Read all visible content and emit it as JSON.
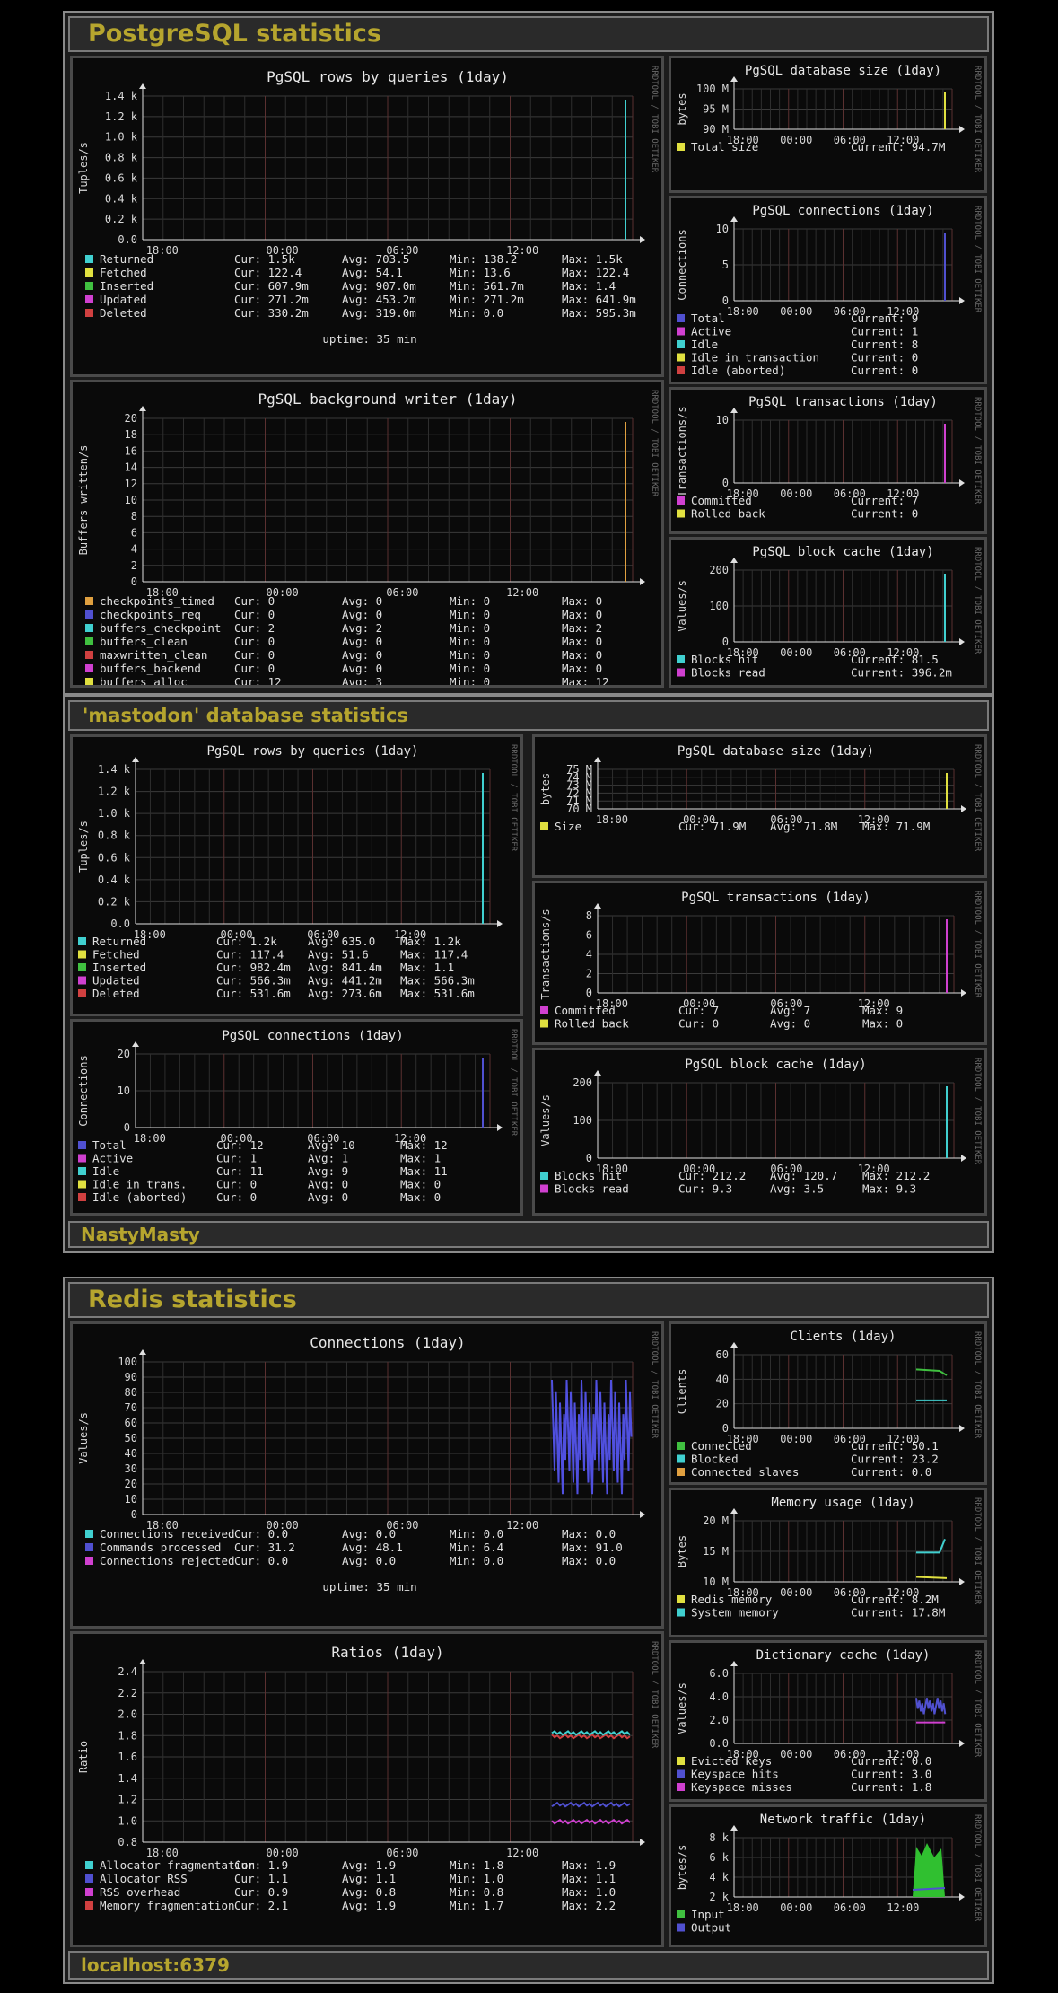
{
  "sections": [
    {
      "title": "PostgreSQL statistics",
      "footer": ""
    },
    {
      "title": "'mastodon' database statistics",
      "footer": "NastyMasty"
    },
    {
      "title": "Redis statistics",
      "footer": "localhost:6379"
    }
  ],
  "watermark": "RRDTOOL / TOBI OETIKER",
  "panels": {
    "pg_rows": {
      "title": "PgSQL rows by queries  (1day)",
      "ylabel": "Tuples/s",
      "yticks": [
        "1.4 k",
        "1.2 k",
        "1.0 k",
        "0.8 k",
        "0.6 k",
        "0.4 k",
        "0.2 k",
        "0.0"
      ],
      "xticks": [
        "18:00",
        "00:00",
        "06:00",
        "12:00"
      ],
      "legend": [
        {
          "color": "#40d0d0",
          "label": "Returned",
          "cur": "Cur:   1.5k",
          "avg": "Avg: 703.5",
          "min": "Min: 138.2",
          "max": "Max:   1.5k"
        },
        {
          "color": "#e0e040",
          "label": "Fetched",
          "cur": "Cur: 122.4",
          "avg": "Avg:  54.1",
          "min": "Min:  13.6",
          "max": "Max: 122.4"
        },
        {
          "color": "#40c040",
          "label": "Inserted",
          "cur": "Cur: 607.9m",
          "avg": "Avg: 907.0m",
          "min": "Min: 561.7m",
          "max": "Max:   1.4"
        },
        {
          "color": "#d040d0",
          "label": "Updated",
          "cur": "Cur: 271.2m",
          "avg": "Avg: 453.2m",
          "min": "Min: 271.2m",
          "max": "Max: 641.9m"
        },
        {
          "color": "#d04040",
          "label": "Deleted",
          "cur": "Cur: 330.2m",
          "avg": "Avg: 319.0m",
          "min": "Min:   0.0",
          "max": "Max: 595.3m"
        }
      ],
      "extra": "uptime:  35 min"
    },
    "pg_bgwriter": {
      "title": "PgSQL background writer  (1day)",
      "ylabel": "Buffers written/s",
      "yticks": [
        "20",
        "18",
        "16",
        "14",
        "12",
        "10",
        "8",
        "6",
        "4",
        "2",
        "0"
      ],
      "xticks": [
        "18:00",
        "00:00",
        "06:00",
        "12:00"
      ],
      "legend": [
        {
          "color": "#e0a040",
          "label": "checkpoints_timed",
          "cur": "Cur:   0",
          "avg": "Avg:   0",
          "min": "Min:   0",
          "max": "Max:   0"
        },
        {
          "color": "#5050d0",
          "label": "checkpoints_req",
          "cur": "Cur:   0",
          "avg": "Avg:   0",
          "min": "Min:   0",
          "max": "Max:   0"
        },
        {
          "color": "#40d0d0",
          "label": "buffers_checkpoint",
          "cur": "Cur:   2",
          "avg": "Avg:   2",
          "min": "Min:   0",
          "max": "Max:   2"
        },
        {
          "color": "#40c040",
          "label": "buffers_clean",
          "cur": "Cur:   0",
          "avg": "Avg:   0",
          "min": "Min:   0",
          "max": "Max:   0"
        },
        {
          "color": "#d04040",
          "label": "maxwritten_clean",
          "cur": "Cur:   0",
          "avg": "Avg:   0",
          "min": "Min:   0",
          "max": "Max:   0"
        },
        {
          "color": "#d040d0",
          "label": "buffers_backend",
          "cur": "Cur:   0",
          "avg": "Avg:   0",
          "min": "Min:   0",
          "max": "Max:   0"
        },
        {
          "color": "#e0e040",
          "label": "buffers_alloc",
          "cur": "Cur:  12",
          "avg": "Avg:   3",
          "min": "Min:   0",
          "max": "Max:  12"
        }
      ]
    },
    "pg_dbsize": {
      "title": "PgSQL database size  (1day)",
      "ylabel": "bytes",
      "yticks": [
        "100 M",
        "95 M",
        "90 M"
      ],
      "xticks": [
        "18:00",
        "00:00",
        "06:00",
        "12:00"
      ],
      "legend": [
        {
          "color": "#e0e040",
          "label": "Total size",
          "cur": "Current:  94.7M"
        }
      ]
    },
    "pg_conn": {
      "title": "PgSQL connections  (1day)",
      "ylabel": "Connections",
      "yticks": [
        "10",
        "5",
        "0"
      ],
      "xticks": [
        "18:00",
        "00:00",
        "06:00",
        "12:00"
      ],
      "legend": [
        {
          "color": "#5050d0",
          "label": "Total",
          "cur": "Current:    9"
        },
        {
          "color": "#d040d0",
          "label": "Active",
          "cur": "Current:    1"
        },
        {
          "color": "#40d0d0",
          "label": "Idle",
          "cur": "Current:    8"
        },
        {
          "color": "#e0e040",
          "label": "Idle in transaction",
          "cur": "Current:    0"
        },
        {
          "color": "#d04040",
          "label": "Idle (aborted)",
          "cur": "Current:    0"
        }
      ]
    },
    "pg_tx": {
      "title": "PgSQL transactions  (1day)",
      "ylabel": "Transactions/s",
      "yticks": [
        "10",
        "0"
      ],
      "xticks": [
        "18:00",
        "00:00",
        "06:00",
        "12:00"
      ],
      "legend": [
        {
          "color": "#d040d0",
          "label": "Committed",
          "cur": "Current:    7"
        },
        {
          "color": "#e0e040",
          "label": "Rolled back",
          "cur": "Current:    0"
        }
      ]
    },
    "pg_cache": {
      "title": "PgSQL block cache  (1day)",
      "ylabel": "Values/s",
      "yticks": [
        "200",
        "100",
        "0"
      ],
      "xticks": [
        "18:00",
        "00:00",
        "06:00",
        "12:00"
      ],
      "legend": [
        {
          "color": "#40d0d0",
          "label": "Blocks hit",
          "cur": "Current:  81.5"
        },
        {
          "color": "#d040d0",
          "label": "Blocks read",
          "cur": "Current: 396.2m"
        }
      ]
    },
    "m_rows": {
      "title": "PgSQL rows by queries  (1day)",
      "ylabel": "Tuples/s",
      "yticks": [
        "1.4 k",
        "1.2 k",
        "1.0 k",
        "0.8 k",
        "0.6 k",
        "0.4 k",
        "0.2 k",
        "0.0"
      ],
      "xticks": [
        "18:00",
        "00:00",
        "06:00",
        "12:00"
      ],
      "legend": [
        {
          "color": "#40d0d0",
          "label": "Returned",
          "cur": "Cur:   1.2k",
          "avg": "Avg: 635.0",
          "max": "Max:   1.2k"
        },
        {
          "color": "#e0e040",
          "label": "Fetched",
          "cur": "Cur: 117.4",
          "avg": "Avg:  51.6",
          "max": "Max: 117.4"
        },
        {
          "color": "#40c040",
          "label": "Inserted",
          "cur": "Cur: 982.4m",
          "avg": "Avg: 841.4m",
          "max": "Max:   1.1"
        },
        {
          "color": "#d040d0",
          "label": "Updated",
          "cur": "Cur: 566.3m",
          "avg": "Avg: 441.2m",
          "max": "Max: 566.3m"
        },
        {
          "color": "#d04040",
          "label": "Deleted",
          "cur": "Cur: 531.6m",
          "avg": "Avg: 273.6m",
          "max": "Max: 531.6m"
        }
      ]
    },
    "m_conn": {
      "title": "PgSQL connections  (1day)",
      "ylabel": "Connections",
      "yticks": [
        "20",
        "10",
        "0"
      ],
      "xticks": [
        "18:00",
        "00:00",
        "06:00",
        "12:00"
      ],
      "legend": [
        {
          "color": "#5050d0",
          "label": "Total",
          "cur": "Cur:   12",
          "avg": "Avg:   10",
          "max": "Max:   12"
        },
        {
          "color": "#d040d0",
          "label": "Active",
          "cur": "Cur:    1",
          "avg": "Avg:    1",
          "max": "Max:    1"
        },
        {
          "color": "#40d0d0",
          "label": "Idle",
          "cur": "Cur:   11",
          "avg": "Avg:    9",
          "max": "Max:   11"
        },
        {
          "color": "#e0e040",
          "label": "Idle in trans.",
          "cur": "Cur:    0",
          "avg": "Avg:    0",
          "max": "Max:    0"
        },
        {
          "color": "#d04040",
          "label": "Idle (aborted)",
          "cur": "Cur:    0",
          "avg": "Avg:    0",
          "max": "Max:    0"
        }
      ]
    },
    "m_dbsize": {
      "title": "PgSQL database size  (1day)",
      "ylabel": "bytes",
      "yticks": [
        "75 M",
        "74 M",
        "73 M",
        "72 M",
        "71 M",
        "70 M"
      ],
      "xticks": [
        "18:00",
        "00:00",
        "06:00",
        "12:00"
      ],
      "legend": [
        {
          "color": "#e0e040",
          "label": "Size",
          "cur": "Cur:  71.9M",
          "avg": "Avg:  71.8M",
          "max": "Max:  71.9M"
        }
      ]
    },
    "m_tx": {
      "title": "PgSQL transactions  (1day)",
      "ylabel": "Transactions/s",
      "yticks": [
        "8",
        "6",
        "4",
        "2",
        "0"
      ],
      "xticks": [
        "18:00",
        "00:00",
        "06:00",
        "12:00"
      ],
      "legend": [
        {
          "color": "#d040d0",
          "label": "Committed",
          "cur": "Cur:    7",
          "avg": "Avg:    7",
          "max": "Max:    9"
        },
        {
          "color": "#e0e040",
          "label": "Rolled back",
          "cur": "Cur:    0",
          "avg": "Avg:    0",
          "max": "Max:    0"
        }
      ]
    },
    "m_cache": {
      "title": "PgSQL block cache  (1day)",
      "ylabel": "Values/s",
      "yticks": [
        "200",
        "100",
        "0"
      ],
      "xticks": [
        "18:00",
        "00:00",
        "06:00",
        "12:00"
      ],
      "legend": [
        {
          "color": "#40d0d0",
          "label": "Blocks hit",
          "cur": "Cur: 212.2",
          "avg": "Avg: 120.7",
          "max": "Max: 212.2"
        },
        {
          "color": "#d040d0",
          "label": "Blocks read",
          "cur": "Cur:   9.3",
          "avg": "Avg:   3.5",
          "max": "Max:   9.3"
        }
      ]
    },
    "r_conn": {
      "title": "Connections  (1day)",
      "ylabel": "Values/s",
      "yticks": [
        "100",
        "90",
        "80",
        "70",
        "60",
        "50",
        "40",
        "30",
        "20",
        "10",
        "0"
      ],
      "xticks": [
        "18:00",
        "00:00",
        "06:00",
        "12:00"
      ],
      "legend": [
        {
          "color": "#40d0d0",
          "label": "Connections received",
          "cur": "Cur:  0.0",
          "avg": "Avg:  0.0",
          "min": "Min:  0.0",
          "max": "Max:  0.0"
        },
        {
          "color": "#5050d0",
          "label": "Commands processed",
          "cur": "Cur: 31.2",
          "avg": "Avg: 48.1",
          "min": "Min:  6.4",
          "max": "Max: 91.0"
        },
        {
          "color": "#d040d0",
          "label": "Connections rejected",
          "cur": "Cur:  0.0",
          "avg": "Avg:  0.0",
          "min": "Min:  0.0",
          "max": "Max:  0.0"
        }
      ],
      "extra": "uptime:  35 min"
    },
    "r_ratios": {
      "title": "Ratios  (1day)",
      "ylabel": "Ratio",
      "yticks": [
        "2.4",
        "2.2",
        "2.0",
        "1.8",
        "1.6",
        "1.4",
        "1.2",
        "1.0",
        "0.8"
      ],
      "xticks": [
        "18:00",
        "00:00",
        "06:00",
        "12:00"
      ],
      "legend": [
        {
          "color": "#40d0d0",
          "label": "Allocator fragmentation",
          "cur": "Cur:  1.9",
          "avg": "Avg:  1.9",
          "min": "Min:  1.8",
          "max": "Max:  1.9"
        },
        {
          "color": "#5050d0",
          "label": "Allocator RSS",
          "cur": "Cur:  1.1",
          "avg": "Avg:  1.1",
          "min": "Min:  1.0",
          "max": "Max:  1.1"
        },
        {
          "color": "#d040d0",
          "label": "RSS overhead",
          "cur": "Cur:  0.9",
          "avg": "Avg:  0.8",
          "min": "Min:  0.8",
          "max": "Max:  1.0"
        },
        {
          "color": "#d04040",
          "label": "Memory fragmentation",
          "cur": "Cur:  2.1",
          "avg": "Avg:  1.9",
          "min": "Min:  1.7",
          "max": "Max:  2.2"
        }
      ]
    },
    "r_clients": {
      "title": "Clients  (1day)",
      "ylabel": "Clients",
      "yticks": [
        "60",
        "40",
        "20",
        "0"
      ],
      "xticks": [
        "18:00",
        "00:00",
        "06:00",
        "12:00"
      ],
      "legend": [
        {
          "color": "#40c040",
          "label": "Connected",
          "cur": "Current: 50.1"
        },
        {
          "color": "#40d0d0",
          "label": "Blocked",
          "cur": "Current: 23.2"
        },
        {
          "color": "#e0a040",
          "label": "Connected slaves",
          "cur": "Current:  0.0"
        }
      ]
    },
    "r_mem": {
      "title": "Memory usage  (1day)",
      "ylabel": "Bytes",
      "yticks": [
        "20 M",
        "15 M",
        "10 M"
      ],
      "xticks": [
        "18:00",
        "00:00",
        "06:00",
        "12:00"
      ],
      "legend": [
        {
          "color": "#e0e040",
          "label": "Redis memory",
          "cur": "Current:  8.2M"
        },
        {
          "color": "#40d0d0",
          "label": "System memory",
          "cur": "Current: 17.8M"
        }
      ]
    },
    "r_dict": {
      "title": "Dictionary cache  (1day)",
      "ylabel": "Values/s",
      "yticks": [
        "6.0",
        "4.0",
        "2.0",
        "0.0"
      ],
      "xticks": [
        "18:00",
        "00:00",
        "06:00",
        "12:00"
      ],
      "legend": [
        {
          "color": "#e0e040",
          "label": "Evicted keys",
          "cur": "Current: 0.0"
        },
        {
          "color": "#5050d0",
          "label": "Keyspace hits",
          "cur": "Current: 3.0"
        },
        {
          "color": "#d040d0",
          "label": "Keyspace misses",
          "cur": "Current: 1.8"
        }
      ]
    },
    "r_net": {
      "title": "Network traffic  (1day)",
      "ylabel": "bytes/s",
      "yticks": [
        "8 k",
        "6 k",
        "4 k",
        "2 k"
      ],
      "xticks": [
        "18:00",
        "00:00",
        "06:00",
        "12:00"
      ],
      "legend": [
        {
          "color": "#40c040",
          "label": "Input",
          "cur": ""
        },
        {
          "color": "#5050d0",
          "label": "Output",
          "cur": ""
        }
      ]
    }
  }
}
